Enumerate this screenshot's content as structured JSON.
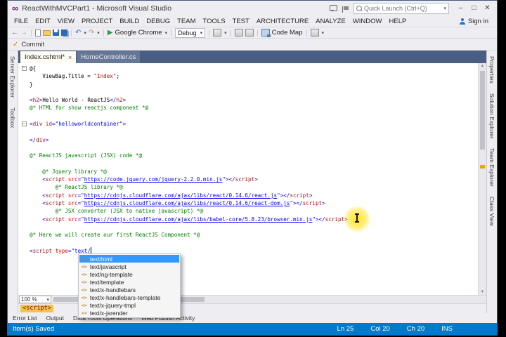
{
  "window": {
    "title": "ReactWithMVCPart1 - Microsoft Visual Studio",
    "quick_launch": "Quick Launch (Ctrl+Q)"
  },
  "icons": {
    "logo": "∞",
    "back": "←",
    "forward": "→",
    "undo": "↶",
    "redo": "↷",
    "run": "▶",
    "chevron": "▾",
    "minimize": "–",
    "maximize": "□",
    "close": "✕",
    "tab_close": "×",
    "commit_check": "✓",
    "scroll_up": "▲",
    "scroll_down": "▼",
    "markup": "<>",
    "fold_collapse": "–"
  },
  "menu": {
    "items": [
      "FILE",
      "EDIT",
      "VIEW",
      "PROJECT",
      "BUILD",
      "DEBUG",
      "TEAM",
      "TOOLS",
      "TEST",
      "ARCHITECTURE",
      "ANALYZE",
      "WINDOW",
      "HELP"
    ],
    "sign_in": "Sign in"
  },
  "toolbar": {
    "browser": "Google Chrome",
    "config": "Debug",
    "code_map": "Code Map",
    "commit": "Commit"
  },
  "side_left": [
    "Server Explorer",
    "Toolbox"
  ],
  "side_right": [
    "Properties",
    "Solution Explorer",
    "Team Explorer",
    "Class View"
  ],
  "tabs": [
    {
      "label": "Index.cshtml*",
      "active": true
    },
    {
      "label": "HomeController.cs",
      "active": false
    }
  ],
  "editor": {
    "zoom": "100 %",
    "breadcrumb": "<script>",
    "lines": [
      {
        "fold": true,
        "tokens": [
          [
            "@{",
            "pl"
          ]
        ]
      },
      {
        "tokens": [
          [
            "    ViewBag.Title = ",
            "pl"
          ],
          [
            "\"Index\"",
            "str"
          ],
          [
            ";",
            "pl"
          ]
        ]
      },
      {
        "tokens": [
          [
            "}",
            "pl"
          ]
        ]
      },
      {
        "tokens": []
      },
      {
        "tokens": [
          [
            "<",
            "delim"
          ],
          [
            "h2",
            "tag"
          ],
          [
            ">",
            "delim"
          ],
          [
            "Hello World - ReactJS",
            "pl"
          ],
          [
            "</",
            "delim"
          ],
          [
            "h2",
            "tag"
          ],
          [
            ">",
            "delim"
          ]
        ]
      },
      {
        "tokens": [
          [
            "@* HTML for show reactjs component *@",
            "cmt"
          ]
        ]
      },
      {
        "tokens": []
      },
      {
        "fold": true,
        "tokens": [
          [
            "<",
            "delim"
          ],
          [
            "div",
            "tag"
          ],
          [
            " ",
            "pl"
          ],
          [
            "id",
            "attr"
          ],
          [
            "=\"",
            "delim"
          ],
          [
            "helloworldcontainer",
            "val"
          ],
          [
            "\"",
            "delim"
          ],
          [
            ">",
            "delim"
          ]
        ]
      },
      {
        "tokens": []
      },
      {
        "tokens": [
          [
            "</",
            "delim"
          ],
          [
            "div",
            "tag"
          ],
          [
            ">",
            "delim"
          ]
        ]
      },
      {
        "tokens": []
      },
      {
        "tokens": [
          [
            "@* ReactJS javascript (JSX) code *@",
            "cmt"
          ]
        ]
      },
      {
        "tokens": []
      },
      {
        "tokens": [
          [
            "    ",
            "pl"
          ],
          [
            "@* Jquery library *@",
            "cmt"
          ]
        ]
      },
      {
        "tokens": [
          [
            "    ",
            "pl"
          ],
          [
            "<",
            "delim"
          ],
          [
            "script",
            "tag"
          ],
          [
            " ",
            "pl"
          ],
          [
            "src",
            "attr"
          ],
          [
            "=\"",
            "delim"
          ],
          [
            "https://code.jquery.com/jquery-2.2.0.min.js",
            "link"
          ],
          [
            "\"></",
            "delim"
          ],
          [
            "script",
            "tag"
          ],
          [
            ">",
            "delim"
          ]
        ]
      },
      {
        "tokens": [
          [
            "        ",
            "pl"
          ],
          [
            "@* ReactJS library *@",
            "cmt"
          ]
        ]
      },
      {
        "tokens": [
          [
            "    ",
            "pl"
          ],
          [
            "<",
            "delim"
          ],
          [
            "script",
            "tag"
          ],
          [
            " ",
            "pl"
          ],
          [
            "src",
            "attr"
          ],
          [
            "=\"",
            "delim"
          ],
          [
            "https://cdnjs.cloudflare.com/ajax/libs/react/0.14.6/react.js",
            "link"
          ],
          [
            "\"></",
            "delim"
          ],
          [
            "script",
            "tag"
          ],
          [
            ">",
            "delim"
          ]
        ]
      },
      {
        "tokens": [
          [
            "    ",
            "pl"
          ],
          [
            "<",
            "delim"
          ],
          [
            "script",
            "tag"
          ],
          [
            " ",
            "pl"
          ],
          [
            "src",
            "attr"
          ],
          [
            "=\"",
            "delim"
          ],
          [
            "https://cdnjs.cloudflare.com/ajax/libs/react/0.14.6/react-dom.js",
            "link"
          ],
          [
            "\"></",
            "delim"
          ],
          [
            "script",
            "tag"
          ],
          [
            ">",
            "delim"
          ]
        ]
      },
      {
        "tokens": [
          [
            "        ",
            "pl"
          ],
          [
            "@* JSX converter (JSX to native javascript) *@",
            "cmt"
          ]
        ]
      },
      {
        "tokens": [
          [
            "    ",
            "pl"
          ],
          [
            "<",
            "delim"
          ],
          [
            "script",
            "tag"
          ],
          [
            " ",
            "pl"
          ],
          [
            "src",
            "attr"
          ],
          [
            "=\"",
            "delim"
          ],
          [
            "https://cdnjs.cloudflare.com/ajax/libs/babel-core/5.8.23/browser.min.js",
            "link"
          ],
          [
            "\"></",
            "delim"
          ],
          [
            "script",
            "tag"
          ],
          [
            ">",
            "delim"
          ]
        ]
      },
      {
        "tokens": []
      },
      {
        "tokens": [
          [
            "@* Here we will create our first ReactJS Component *@",
            "cmt"
          ]
        ]
      },
      {
        "tokens": []
      },
      {
        "caret": true,
        "tokens": [
          [
            "<",
            "delim"
          ],
          [
            "script",
            "tag"
          ],
          [
            " ",
            "pl"
          ],
          [
            "type",
            "attr"
          ],
          [
            "=\"",
            "delim"
          ],
          [
            "text/",
            "val"
          ]
        ]
      }
    ]
  },
  "intellisense": {
    "selected": 0,
    "items": [
      "text/html",
      "text/javascript",
      "text/ng-template",
      "text/template",
      "text/x-handlebars",
      "text/x-handlebars-template",
      "text/x-jquery-tmpl",
      "text/x-jsrender"
    ]
  },
  "panel_tabs": [
    "Error List",
    "Output",
    "Data Tools Operations",
    "Web Publish Activity"
  ],
  "status": {
    "message": "Item(s) Saved",
    "line": "Ln 25",
    "col": "Col 20",
    "ch": "Ch 20",
    "mode": "INS"
  }
}
